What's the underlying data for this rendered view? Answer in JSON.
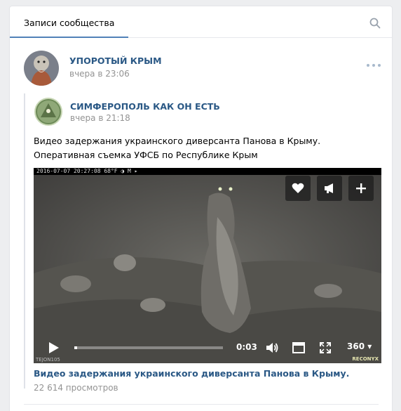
{
  "tabs": {
    "active_label": "Записи сообщества"
  },
  "post": {
    "author": "УПОРОТЫЙ КРЫМ",
    "time": "вчера в 23:06",
    "repost": {
      "author": "СИМФЕРОПОЛЬ КАК ОН ЕСТЬ",
      "time": "вчера в 21:18",
      "text": "Видео задержания украинского диверсанта Панова в Крыму. Оперативная съемка УФСБ по Республике Крым",
      "video": {
        "camera_stamp": "2016-07-07 20:27:08      68°F  ◑        M ▸",
        "camera_id": "TEJON105",
        "watermark": "RECONYX",
        "current_time": "0:03",
        "quality": "360",
        "progress": 0.02,
        "title": "Видео задержания украинского диверсанта Панова в Крыму.",
        "views": "22 614 просмотров"
      }
    }
  },
  "colors": {
    "link": "#2a5885",
    "accent": "#5181b8",
    "muted": "#939393"
  }
}
